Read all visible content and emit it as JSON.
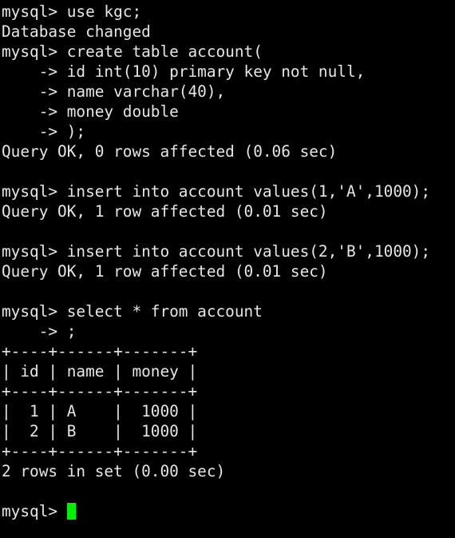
{
  "terminal": {
    "title": "mysql-client-session",
    "background_color": "#000000",
    "text_color": "#e6e6e6",
    "cursor_color": "#00f000",
    "prompt": "mysql>",
    "continuation_prompt": "->",
    "lines": [
      "mysql> use kgc;",
      "Database changed",
      "mysql> create table account(",
      "    -> id int(10) primary key not null,",
      "    -> name varchar(40),",
      "    -> money double",
      "    -> );",
      "Query OK, 0 rows affected (0.06 sec)",
      "",
      "mysql> insert into account values(1,'A',1000);",
      "Query OK, 1 row affected (0.01 sec)",
      "",
      "mysql> insert into account values(2,'B',1000);",
      "Query OK, 1 row affected (0.01 sec)",
      "",
      "mysql> select * from account",
      "    -> ;",
      "+----+------+-------+",
      "| id | name | money |",
      "+----+------+-------+",
      "|  1 | A    |  1000 |",
      "|  2 | B    |  1000 |",
      "+----+------+-------+",
      "2 rows in set (0.00 sec)",
      ""
    ],
    "final_prompt": "mysql> ",
    "result_table": {
      "columns": [
        "id",
        "name",
        "money"
      ],
      "rows": [
        [
          "1",
          "A",
          "1000"
        ],
        [
          "2",
          "B",
          "1000"
        ]
      ],
      "row_count_text": "2 rows in set (0.00 sec)"
    },
    "statements": [
      {
        "command": "use kgc;",
        "result": "Database changed"
      },
      {
        "command": "create table account( id int(10) primary key not null, name varchar(40), money double );",
        "result": "Query OK, 0 rows affected (0.06 sec)"
      },
      {
        "command": "insert into account values(1,'A',1000);",
        "result": "Query OK, 1 row affected (0.01 sec)"
      },
      {
        "command": "insert into account values(2,'B',1000);",
        "result": "Query OK, 1 row affected (0.01 sec)"
      },
      {
        "command": "select * from account ;",
        "result": "2 rows in set (0.00 sec)"
      }
    ]
  }
}
